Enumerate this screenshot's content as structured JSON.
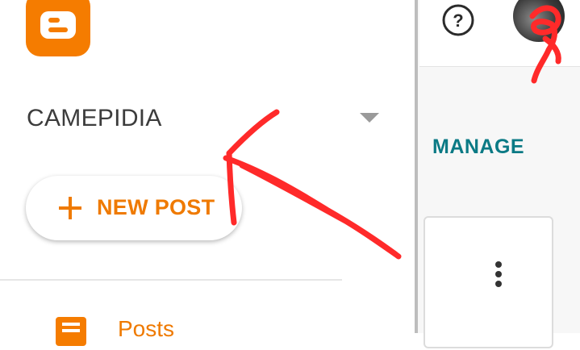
{
  "app": {
    "name": "Blogger"
  },
  "drawer": {
    "blog_name": "CAMEPIDIA",
    "new_post_label": "NEW POST",
    "nav": [
      {
        "label": "Posts",
        "icon": "posts-icon"
      }
    ]
  },
  "background": {
    "manage_label": "MANAGE",
    "help_icon_symbol": "?"
  },
  "colors": {
    "brand_orange": "#f57c00",
    "manage_teal": "#0b7a85",
    "annotation_red": "#ff2a2a"
  }
}
